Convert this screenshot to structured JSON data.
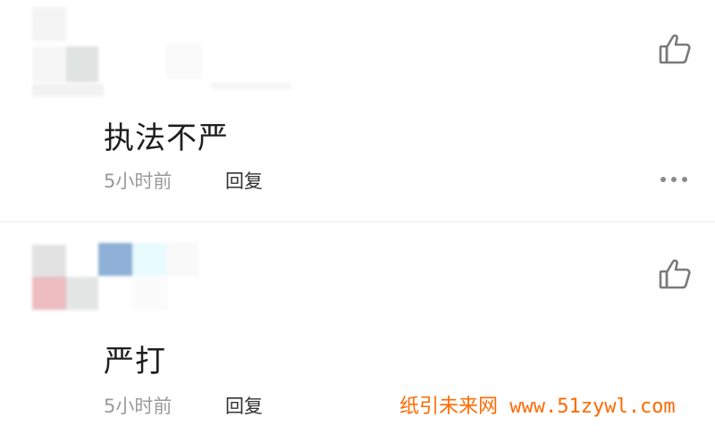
{
  "comments": [
    {
      "text": "执法不严",
      "time": "5小时前",
      "reply_label": "回复",
      "like_icon": "thumbs-up-icon",
      "more_icon": "more-dots-icon"
    },
    {
      "text": "严打",
      "time": "5小时前",
      "reply_label": "回复",
      "like_icon": "thumbs-up-icon"
    }
  ],
  "watermark": "纸引未来网 www.51zywl.com",
  "colors": {
    "comment_text": "#1f1f1f",
    "time_text": "#9a9a9a",
    "reply_text": "#333333",
    "divider": "#ececec",
    "watermark": "#ff6a00"
  }
}
